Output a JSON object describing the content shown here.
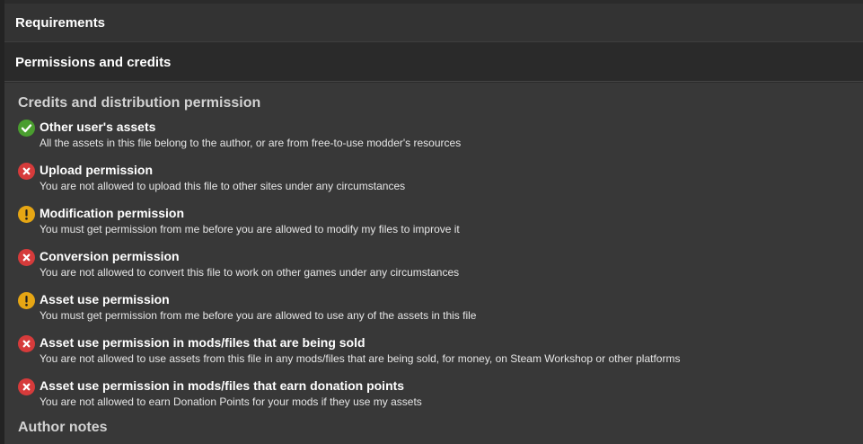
{
  "accordion": {
    "requirements_label": "Requirements",
    "permissions_label": "Permissions and credits"
  },
  "credits": {
    "title": "Credits and distribution permission",
    "items": [
      {
        "status": "allowed",
        "icon": "check-icon",
        "color": "#4a9e2f",
        "title": "Other user's assets",
        "description": "All the assets in this file belong to the author, or are from free-to-use modder's resources"
      },
      {
        "status": "denied",
        "icon": "cross-icon",
        "color": "#d63b3b",
        "title": "Upload permission",
        "description": "You are not allowed to upload this file to other sites under any circumstances"
      },
      {
        "status": "conditional",
        "icon": "exclamation-icon",
        "color": "#e6a614",
        "title": "Modification permission",
        "description": "You must get permission from me before you are allowed to modify my files to improve it"
      },
      {
        "status": "denied",
        "icon": "cross-icon",
        "color": "#d63b3b",
        "title": "Conversion permission",
        "description": "You are not allowed to convert this file to work on other games under any circumstances"
      },
      {
        "status": "conditional",
        "icon": "exclamation-icon",
        "color": "#e6a614",
        "title": "Asset use permission",
        "description": "You must get permission from me before you are allowed to use any of the assets in this file"
      },
      {
        "status": "denied",
        "icon": "cross-icon",
        "color": "#d63b3b",
        "title": "Asset use permission in mods/files that are being sold",
        "description": "You are not allowed to use assets from this file in any mods/files that are being sold, for money, on Steam Workshop or other platforms"
      },
      {
        "status": "denied",
        "icon": "cross-icon",
        "color": "#d63b3b",
        "title": "Asset use permission in mods/files that earn donation points",
        "description": "You are not allowed to earn Donation Points for your mods if they use my assets"
      }
    ]
  },
  "author_notes": {
    "title": "Author notes"
  }
}
